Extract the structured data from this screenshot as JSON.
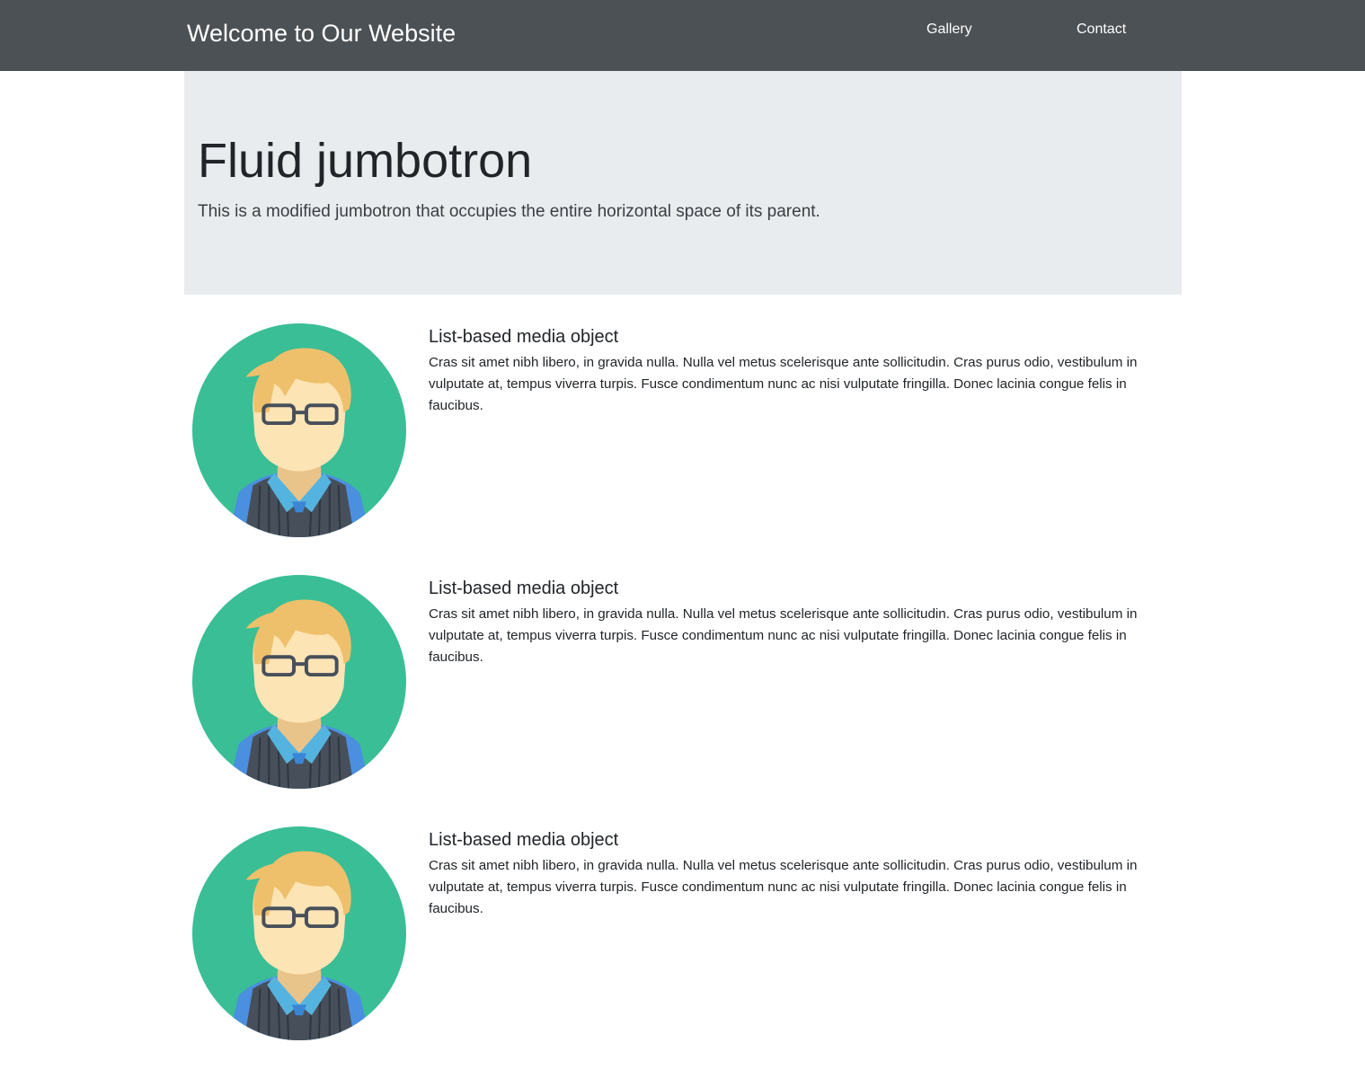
{
  "navbar": {
    "brand": "Welcome to Our Website",
    "links": [
      "Gallery",
      "Contact"
    ],
    "background": "#4b5155"
  },
  "jumbotron": {
    "title": "Fluid jumbotron",
    "lead": "This is a modified jumbotron that occupies the entire horizontal space of its parent.",
    "background": "#e9ecef"
  },
  "media": [
    {
      "avatar_icon": "person-with-glasses-avatar",
      "heading": "List-based media object",
      "text": "Cras sit amet nibh libero, in gravida nulla. Nulla vel metus scelerisque ante sollicitudin. Cras purus odio, vestibulum in vulputate at, tempus viverra turpis. Fusce condimentum nunc ac nisi vulputate fringilla. Donec lacinia congue felis in faucibus."
    },
    {
      "avatar_icon": "person-with-glasses-avatar",
      "heading": "List-based media object",
      "text": "Cras sit amet nibh libero, in gravida nulla. Nulla vel metus scelerisque ante sollicitudin. Cras purus odio, vestibulum in vulputate at, tempus viverra turpis. Fusce condimentum nunc ac nisi vulputate fringilla. Donec lacinia congue felis in faucibus."
    },
    {
      "avatar_icon": "person-with-glasses-avatar",
      "heading": "List-based media object",
      "text": "Cras sit amet nibh libero, in gravida nulla. Nulla vel metus scelerisque ante sollicitudin. Cras purus odio, vestibulum in vulputate at, tempus viverra turpis. Fusce condimentum nunc ac nisi vulputate fringilla. Donec lacinia congue felis in faucibus."
    }
  ],
  "colors": {
    "avatar_bg": "#3abe96",
    "hair": "#eec06b",
    "skin": "#fde4b4",
    "shirt": "#55b3e0",
    "vest": "#474f5a"
  }
}
